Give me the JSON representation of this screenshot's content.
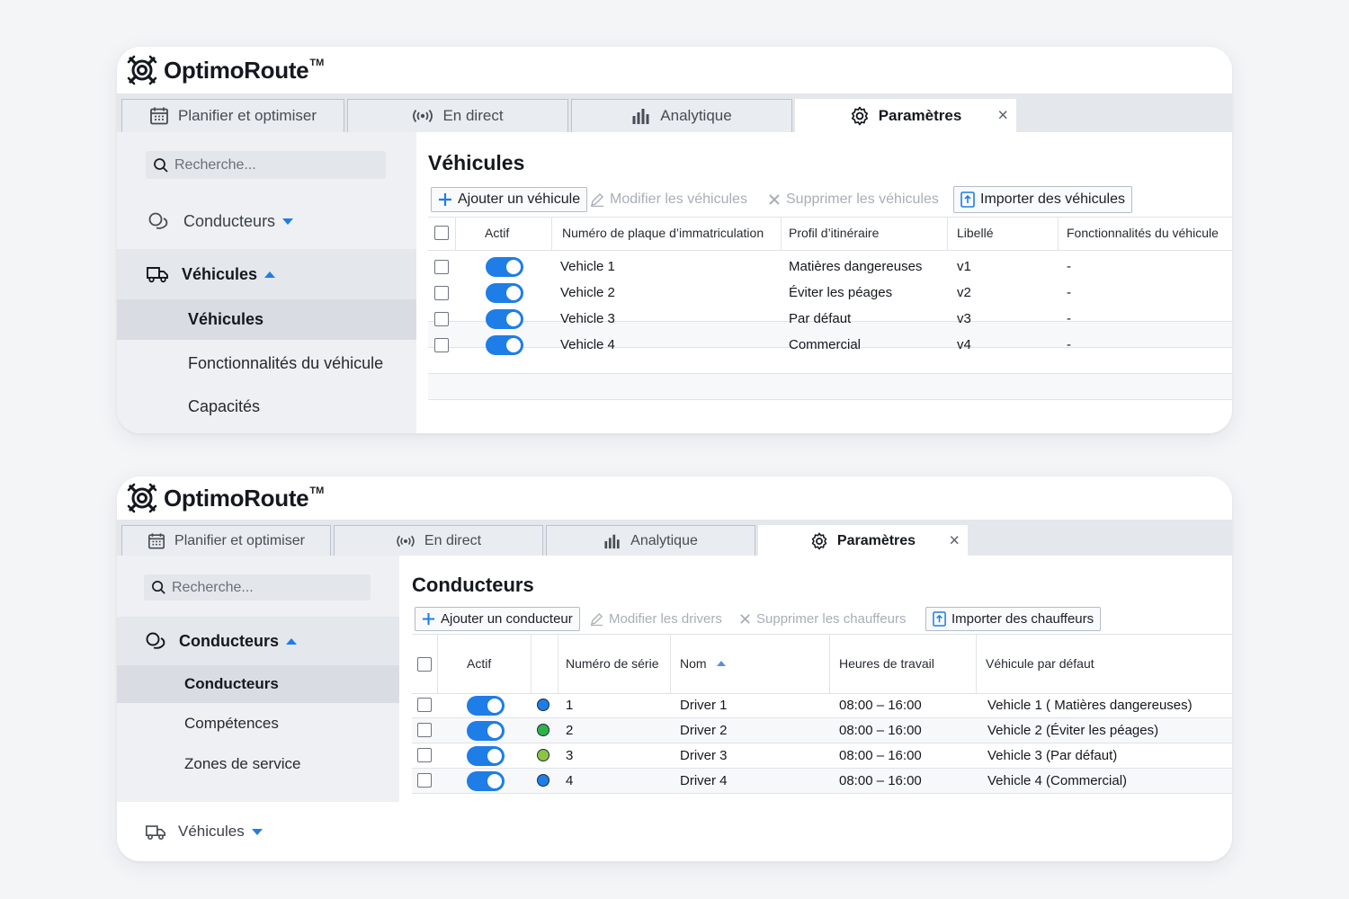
{
  "brand": {
    "name": "OptimoRoute",
    "tm": "TM"
  },
  "tabs": [
    {
      "label": "Planifier et optimiser",
      "icon": "calendar-icon"
    },
    {
      "label": "En direct",
      "icon": "broadcast-icon"
    },
    {
      "label": "Analytique",
      "icon": "bar-chart-icon"
    },
    {
      "label": "Paramètres",
      "icon": "gear-icon",
      "active": true,
      "close": "×"
    }
  ],
  "colors": {
    "accent": "#1e7de6",
    "dot_blue": "#1e7de6",
    "dot_green": "#2fb344",
    "dot_lime": "#8cc63f"
  },
  "vehicles_screen": {
    "search_placeholder": "Recherche...",
    "nav": {
      "drivers": "Conducteurs",
      "vehicles": "Véhicules",
      "sub": [
        "Véhicules",
        "Fonctionnalités du véhicule",
        "Capacités"
      ]
    },
    "title": "Véhicules",
    "toolbar": {
      "add": "Ajouter un véhicule",
      "edit": "Modifier les véhicules",
      "delete": "Supprimer les véhicules",
      "import": "Importer des véhicules"
    },
    "columns": [
      "Actif",
      "Numéro de plaque d’immatriculation",
      "Profil d’itinéraire",
      "Libellé",
      "Fonctionnalités du véhicule"
    ],
    "rows": [
      {
        "plate": "Vehicle 1",
        "profile": "Matières dangereuses",
        "label": "v1",
        "features": "-"
      },
      {
        "plate": "Vehicle 2",
        "profile": "Éviter les péages",
        "label": "v2",
        "features": "-"
      },
      {
        "plate": "Vehicle 3",
        "profile": "Par défaut",
        "label": "v3",
        "features": "-"
      },
      {
        "plate": "Vehicle 4",
        "profile": "Commercial",
        "label": "v4",
        "features": "-"
      }
    ]
  },
  "drivers_screen": {
    "search_placeholder": "Recherche...",
    "nav": {
      "drivers": "Conducteurs",
      "sub": [
        "Conducteurs",
        "Compétences",
        "Zones de service"
      ],
      "vehicles": "Véhicules"
    },
    "title": "Conducteurs",
    "toolbar": {
      "add": "Ajouter un conducteur",
      "edit": "Modifier les drivers",
      "delete": "Supprimer les chauffeurs",
      "import": "Importer des chauffeurs"
    },
    "columns": [
      "Actif",
      "Numéro de série",
      "Nom",
      "Heures de travail",
      "Véhicule par défaut"
    ],
    "rows": [
      {
        "serial": "1",
        "name": "Driver 1",
        "hours": "08:00 – 16:00",
        "vehicle": "Vehicle 1 ( Matières dangereuses)",
        "dot": "blue"
      },
      {
        "serial": "2",
        "name": "Driver 2",
        "hours": "08:00 – 16:00",
        "vehicle": "Vehicle 2 (Éviter les péages)",
        "dot": "green"
      },
      {
        "serial": "3",
        "name": "Driver 3",
        "hours": "08:00 – 16:00",
        "vehicle": "Vehicle 3 (Par défaut)",
        "dot": "lime"
      },
      {
        "serial": "4",
        "name": "Driver 4",
        "hours": "08:00 – 16:00",
        "vehicle": "Vehicle 4 (Commercial)",
        "dot": "blue"
      }
    ]
  }
}
